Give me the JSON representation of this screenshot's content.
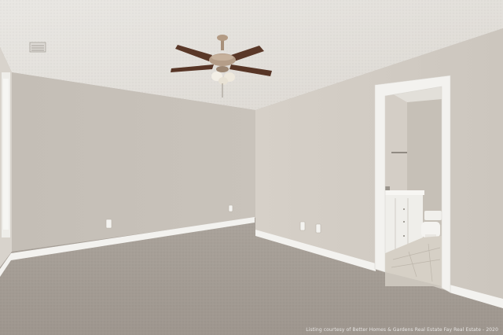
{
  "photo": {
    "subject": "empty bedroom",
    "watermark": "Listing courtesy of Better Homes & Gardens Real Estate Fay Real Estate - 2020"
  },
  "scene_elements": {
    "ceiling": "textured ceiling",
    "fixture": "ceiling fan with light",
    "floor": "beige carpet",
    "doorway": "open door to bathroom"
  },
  "colors": {
    "ceiling": "#e6e3de",
    "wall_left": "#c9c3bb",
    "wall_right": "#d2ccc4",
    "carpet": "#a59d95",
    "trim": "#f3f2ef",
    "bath_tile": "#d6d0c6",
    "fan_blade": "#5a3828",
    "fan_brass": "#a8907a"
  }
}
